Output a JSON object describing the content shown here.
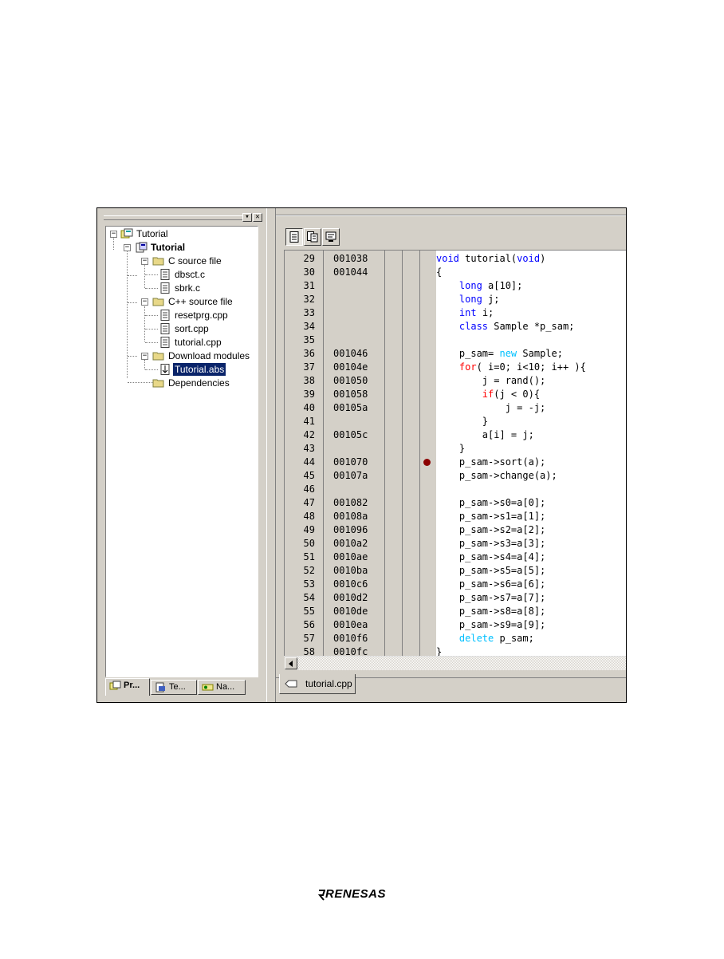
{
  "left_panel": {
    "tree": {
      "root": "Tutorial",
      "project": "Tutorial",
      "c_folder": "C source file",
      "c_files": [
        "dbsct.c",
        "sbrk.c"
      ],
      "cpp_folder": "C++ source file",
      "cpp_files": [
        "resetprg.cpp",
        "sort.cpp",
        "tutorial.cpp"
      ],
      "download_folder": "Download modules",
      "download_file": "Tutorial.abs",
      "dependencies": "Dependencies"
    },
    "tabs": [
      "Pr...",
      "Te...",
      "Na..."
    ]
  },
  "editor": {
    "tab_label": "tutorial.cpp",
    "lines": [
      {
        "n": "29",
        "addr": "001038",
        "code": [
          [
            "b",
            "void"
          ],
          [
            "t",
            " tutorial("
          ],
          [
            "b",
            "void"
          ],
          [
            "t",
            ")"
          ]
        ]
      },
      {
        "n": "30",
        "addr": "001044",
        "code": [
          [
            "t",
            "{"
          ]
        ]
      },
      {
        "n": "31",
        "addr": "",
        "code": [
          [
            "t",
            "    "
          ],
          [
            "b",
            "long"
          ],
          [
            "t",
            " a[10];"
          ]
        ]
      },
      {
        "n": "32",
        "addr": "",
        "code": [
          [
            "t",
            "    "
          ],
          [
            "b",
            "long"
          ],
          [
            "t",
            " j;"
          ]
        ]
      },
      {
        "n": "33",
        "addr": "",
        "code": [
          [
            "t",
            "    "
          ],
          [
            "b",
            "int"
          ],
          [
            "t",
            " i;"
          ]
        ]
      },
      {
        "n": "34",
        "addr": "",
        "code": [
          [
            "t",
            "    "
          ],
          [
            "b",
            "class"
          ],
          [
            "t",
            " Sample *p_sam;"
          ]
        ]
      },
      {
        "n": "35",
        "addr": "",
        "code": []
      },
      {
        "n": "36",
        "addr": "001046",
        "code": [
          [
            "t",
            "    p_sam= "
          ],
          [
            "c",
            "new"
          ],
          [
            "t",
            " Sample;"
          ]
        ]
      },
      {
        "n": "37",
        "addr": "00104e",
        "code": [
          [
            "t",
            "    "
          ],
          [
            "r",
            "for"
          ],
          [
            "t",
            "( i=0; i<10; i++ ){"
          ]
        ]
      },
      {
        "n": "38",
        "addr": "001050",
        "code": [
          [
            "t",
            "        j = rand();"
          ]
        ]
      },
      {
        "n": "39",
        "addr": "001058",
        "code": [
          [
            "t",
            "        "
          ],
          [
            "r",
            "if"
          ],
          [
            "t",
            "(j < 0){"
          ]
        ]
      },
      {
        "n": "40",
        "addr": "00105a",
        "code": [
          [
            "t",
            "            j = -j;"
          ]
        ]
      },
      {
        "n": "41",
        "addr": "",
        "code": [
          [
            "t",
            "        }"
          ]
        ]
      },
      {
        "n": "42",
        "addr": "00105c",
        "code": [
          [
            "t",
            "        a[i] = j;"
          ]
        ]
      },
      {
        "n": "43",
        "addr": "",
        "code": [
          [
            "t",
            "    }"
          ]
        ]
      },
      {
        "n": "44",
        "addr": "001070",
        "code": [
          [
            "t",
            "    p_sam->sort(a);"
          ]
        ],
        "breakpoint": true
      },
      {
        "n": "45",
        "addr": "00107a",
        "code": [
          [
            "t",
            "    p_sam->change(a);"
          ]
        ]
      },
      {
        "n": "46",
        "addr": "",
        "code": []
      },
      {
        "n": "47",
        "addr": "001082",
        "code": [
          [
            "t",
            "    p_sam->s0=a[0];"
          ]
        ]
      },
      {
        "n": "48",
        "addr": "00108a",
        "code": [
          [
            "t",
            "    p_sam->s1=a[1];"
          ]
        ]
      },
      {
        "n": "49",
        "addr": "001096",
        "code": [
          [
            "t",
            "    p_sam->s2=a[2];"
          ]
        ]
      },
      {
        "n": "50",
        "addr": "0010a2",
        "code": [
          [
            "t",
            "    p_sam->s3=a[3];"
          ]
        ]
      },
      {
        "n": "51",
        "addr": "0010ae",
        "code": [
          [
            "t",
            "    p_sam->s4=a[4];"
          ]
        ]
      },
      {
        "n": "52",
        "addr": "0010ba",
        "code": [
          [
            "t",
            "    p_sam->s5=a[5];"
          ]
        ]
      },
      {
        "n": "53",
        "addr": "0010c6",
        "code": [
          [
            "t",
            "    p_sam->s6=a[6];"
          ]
        ]
      },
      {
        "n": "54",
        "addr": "0010d2",
        "code": [
          [
            "t",
            "    p_sam->s7=a[7];"
          ]
        ]
      },
      {
        "n": "55",
        "addr": "0010de",
        "code": [
          [
            "t",
            "    p_sam->s8=a[8];"
          ]
        ]
      },
      {
        "n": "56",
        "addr": "0010ea",
        "code": [
          [
            "t",
            "    p_sam->s9=a[9];"
          ]
        ]
      },
      {
        "n": "57",
        "addr": "0010f6",
        "code": [
          [
            "t",
            "    "
          ],
          [
            "c",
            "delete"
          ],
          [
            "t",
            " p_sam;"
          ]
        ]
      },
      {
        "n": "58",
        "addr": "0010fc",
        "code": [
          [
            "t",
            "}"
          ]
        ]
      }
    ]
  },
  "colors": {
    "keyword_blue": "#0000ff",
    "keyword_red": "#ff0000",
    "keyword_cyan": "#00c0ff",
    "breakpoint": "#8b0000",
    "selection": "#0a246a"
  },
  "footer": {
    "logo": "RENESAS"
  }
}
